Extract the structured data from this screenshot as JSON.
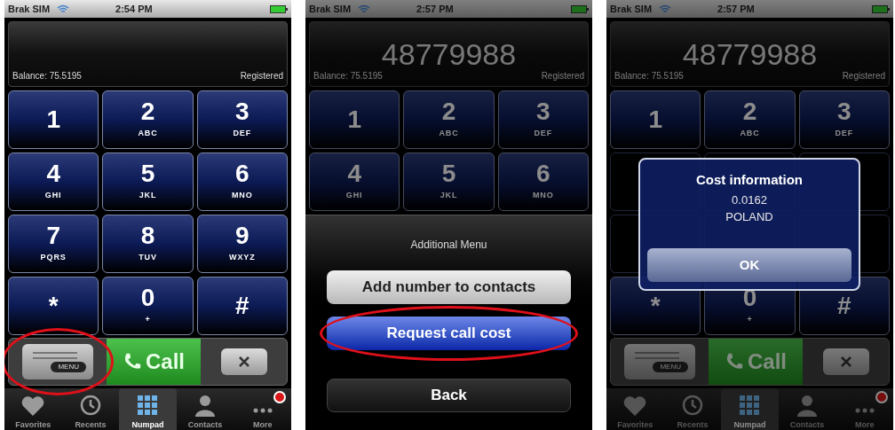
{
  "screens": [
    {
      "dimmed": false,
      "status": {
        "carrier": "Brak SIM",
        "time": "2:54 PM"
      },
      "display": {
        "balance": "Balance: 75.5195",
        "registration": "Registered"
      },
      "keys": [
        {
          "digit": "1"
        },
        {
          "digit": "2",
          "letters": "ABC"
        },
        {
          "digit": "3",
          "letters": "DEF"
        },
        {
          "digit": "4",
          "letters": "GHI"
        },
        {
          "digit": "5",
          "letters": "JKL"
        },
        {
          "digit": "6",
          "letters": "MNO"
        },
        {
          "digit": "7",
          "letters": "PQRS"
        },
        {
          "digit": "8",
          "letters": "TUV"
        },
        {
          "digit": "9",
          "letters": "WXYZ"
        },
        {
          "digit": "*"
        },
        {
          "digit": "0",
          "letters": "+"
        },
        {
          "digit": "#"
        }
      ],
      "action_bar": {
        "menu_label": "MENU",
        "menu_circled": true,
        "call_label": "Call"
      },
      "tabs": [
        {
          "label": "Favorites",
          "selected": false
        },
        {
          "label": "Recents",
          "selected": false
        },
        {
          "label": "Numpad",
          "selected": true
        },
        {
          "label": "Contacts",
          "selected": false
        },
        {
          "label": "More",
          "selected": false,
          "badge": true
        }
      ]
    },
    {
      "dimmed": true,
      "status": {
        "carrier": "Brak SIM",
        "time": "2:57 PM"
      },
      "display": {
        "number": "48779988",
        "balance": "Balance: 75.5195",
        "registration": "Registered"
      },
      "keys": [
        {
          "digit": "1"
        },
        {
          "digit": "2",
          "letters": "ABC"
        },
        {
          "digit": "3",
          "letters": "DEF"
        },
        {
          "digit": "4",
          "letters": "GHI"
        },
        {
          "digit": "5",
          "letters": "JKL"
        },
        {
          "digit": "6",
          "letters": "MNO"
        }
      ],
      "overlay": {
        "kind": "action_sheet",
        "title": "Additional Menu",
        "buttons": [
          {
            "label": "Add number to contacts",
            "kind": "light",
            "circled": false
          },
          {
            "label": "Request call cost",
            "kind": "blue",
            "circled": true
          },
          {
            "label": "Back",
            "kind": "dark",
            "circled": false
          }
        ]
      }
    },
    {
      "dimmed": true,
      "status": {
        "carrier": "Brak SIM",
        "time": "2:57 PM"
      },
      "display": {
        "number": "48779988",
        "balance": "Balance: 75.5195",
        "registration": "Registered"
      },
      "keys": [
        {
          "digit": "1"
        },
        {
          "digit": "2",
          "letters": "ABC"
        },
        {
          "digit": "3",
          "letters": "DEF"
        },
        {
          "covered": true
        },
        {
          "covered": true
        },
        {
          "covered": true
        },
        {
          "covered": true
        },
        {
          "covered": true
        },
        {
          "covered": true
        },
        {
          "digit": "*"
        },
        {
          "digit": "0",
          "letters": "+"
        },
        {
          "digit": "#"
        }
      ],
      "action_bar": {
        "menu_label": "MENU",
        "menu_circled": false,
        "call_label": "Call"
      },
      "tabs": [
        {
          "label": "Favorites",
          "selected": false
        },
        {
          "label": "Recents",
          "selected": false
        },
        {
          "label": "Numpad",
          "selected": true
        },
        {
          "label": "Contacts",
          "selected": false
        },
        {
          "label": "More",
          "selected": false,
          "badge": true
        }
      ],
      "overlay": {
        "kind": "alert",
        "title": "Cost information",
        "lines": [
          "0.0162",
          "POLAND"
        ],
        "button": "OK"
      }
    }
  ]
}
